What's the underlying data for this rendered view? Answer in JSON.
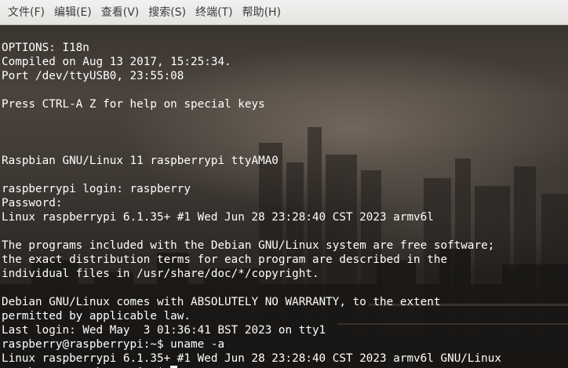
{
  "menu": {
    "items": [
      {
        "id": "file",
        "label": "文件(F)"
      },
      {
        "id": "edit",
        "label": "编辑(E)"
      },
      {
        "id": "view",
        "label": "查看(V)"
      },
      {
        "id": "search",
        "label": "搜索(S)"
      },
      {
        "id": "terminal",
        "label": "终端(T)"
      },
      {
        "id": "help",
        "label": "帮助(H)"
      }
    ]
  },
  "terminal": {
    "lines": [
      "OPTIONS: I18n",
      "Compiled on Aug 13 2017, 15:25:34.",
      "Port /dev/ttyUSB0, 23:55:08",
      "",
      "Press CTRL-A Z for help on special keys",
      "",
      "",
      "",
      "Raspbian GNU/Linux 11 raspberrypi ttyAMA0",
      "",
      "raspberrypi login: raspberry",
      "Password:",
      "Linux raspberrypi 6.1.35+ #1 Wed Jun 28 23:28:40 CST 2023 armv6l",
      "",
      "The programs included with the Debian GNU/Linux system are free software;",
      "the exact distribution terms for each program are described in the",
      "individual files in /usr/share/doc/*/copyright.",
      "",
      "Debian GNU/Linux comes with ABSOLUTELY NO WARRANTY, to the extent",
      "permitted by applicable law.",
      "Last login: Wed May  3 01:36:41 BST 2023 on tty1",
      "raspberry@raspberrypi:~$ uname -a",
      "Linux raspberrypi 6.1.35+ #1 Wed Jun 28 23:28:40 CST 2023 armv6l GNU/Linux"
    ],
    "prompt": "raspberry@raspberrypi:~$ ",
    "text_color": "#ffffff",
    "menu_bg": "#f2f1f0"
  }
}
